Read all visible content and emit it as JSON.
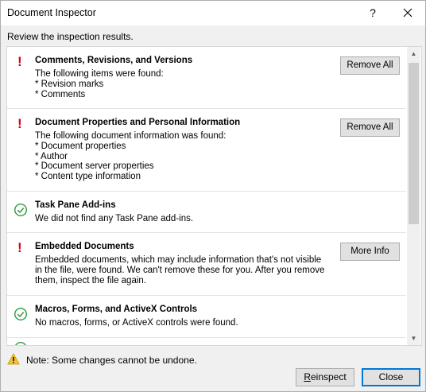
{
  "window": {
    "title": "Document Inspector",
    "help": "?"
  },
  "subtitle": "Review the inspection results.",
  "sections": [
    {
      "status": "warning",
      "title": "Comments, Revisions, and Versions",
      "lines": [
        "The following items were found:",
        "* Revision marks",
        "* Comments"
      ],
      "button": "Remove All"
    },
    {
      "status": "warning",
      "title": "Document Properties and Personal Information",
      "lines": [
        "The following document information was found:",
        "* Document properties",
        "* Author",
        "* Document server properties",
        "* Content type information"
      ],
      "button": "Remove All"
    },
    {
      "status": "ok",
      "title": "Task Pane Add-ins",
      "lines": [
        "We did not find any Task Pane add-ins."
      ]
    },
    {
      "status": "warning",
      "title": "Embedded Documents",
      "lines": [
        "Embedded documents, which may include information that's not visible",
        "in the file, were found. We can't remove these for you. After you remove",
        "them, inspect the file again."
      ],
      "button": "More Info"
    },
    {
      "status": "ok",
      "title": "Macros, Forms, and ActiveX Controls",
      "lines": [
        "No macros, forms, or ActiveX controls were found."
      ]
    }
  ],
  "note": "Note: Some changes cannot be undone.",
  "buttons": {
    "reinspect_mnemonic": "R",
    "reinspect_rest": "einspect",
    "close": "Close"
  },
  "colors": {
    "warning": "#d0021b",
    "ok": "#2e9b46",
    "accent": "#0078d7"
  },
  "icons": {
    "warning_status": "exclamation",
    "ok_status": "check-circle",
    "note": "warning-triangle"
  }
}
